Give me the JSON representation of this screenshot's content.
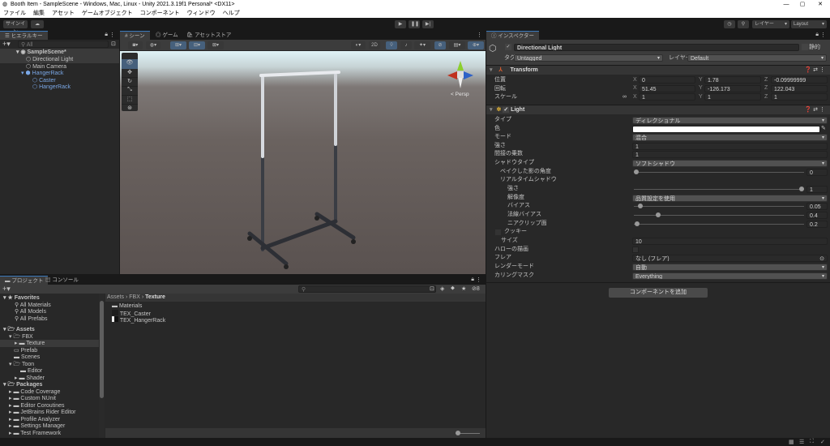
{
  "window": {
    "title": "Booth Item - SampleScene - Windows, Mac, Linux - Unity 2021.3.19f1 Personal* <DX11>"
  },
  "menu": [
    "ファイル",
    "編集",
    "アセット",
    "ゲームオブジェクト",
    "コンポーネント",
    "ウィンドウ",
    "ヘルプ"
  ],
  "toolbar": {
    "signin": "サインイン",
    "layers": "レイヤー",
    "layout": "Layout"
  },
  "hierarchy": {
    "tab": "ヒエラルキー",
    "search_placeholder": "All",
    "scene": "SampleScene*",
    "items": [
      "Directional Light",
      "Main Camera",
      "HangerRack",
      "Caster",
      "HangerRack"
    ]
  },
  "scene": {
    "tabs": [
      "シーン",
      "ゲーム",
      "アセットストア"
    ],
    "mode2d": "2D",
    "persp": "Persp"
  },
  "inspector": {
    "tab": "インスペクター",
    "object_name": "Directional Light",
    "static": "静的",
    "tag_label": "タグ",
    "tag": "Untagged",
    "layer_label": "レイヤー",
    "layer": "Default",
    "transform": {
      "title": "Transform",
      "position_label": "位置",
      "rotation_label": "回転",
      "scale_label": "スケール",
      "position": {
        "x": "0",
        "y": "1.78",
        "z": "-0.09999999"
      },
      "rotation": {
        "x": "51.45",
        "y": "-126.173",
        "z": "122.043"
      },
      "scale": {
        "x": "1",
        "y": "1",
        "z": "1"
      }
    },
    "light": {
      "title": "Light",
      "type_label": "タイプ",
      "type": "ディレクショナル",
      "color_label": "色",
      "color": "#ffffff",
      "mode_label": "モード",
      "mode": "混合",
      "intensity_label": "強さ",
      "intensity": "1",
      "indirect_label": "間接の乗数",
      "indirect": "1",
      "shadow_type_label": "シャドウタイプ",
      "shadow_type": "ソフトシャドウ",
      "baked_angle_label": "ベイクした影の角度",
      "baked_angle": "0",
      "realtime_label": "リアルタイムシャドウ",
      "strength_label": "強さ",
      "strength": "1",
      "resolution_label": "解像度",
      "resolution": "品質設定を使用",
      "bias_label": "バイアス",
      "bias": "0.05",
      "normal_bias_label": "法線バイアス",
      "normal_bias": "0.4",
      "near_plane_label": "ニアクリップ面",
      "near_plane": "0.2",
      "cookie_label": "クッキー",
      "size_label": "サイズ",
      "size": "10",
      "halo_label": "ハローの描画",
      "flare_label": "フレア",
      "flare": "なし (フレア)",
      "render_mode_label": "レンダーモード",
      "render_mode": "自動",
      "culling_label": "カリングマスク",
      "culling": "Everything"
    },
    "add_component": "コンポーネントを追加"
  },
  "project": {
    "tabs": [
      "プロジェクト",
      "コンソール"
    ],
    "favorites": {
      "title": "Favorites",
      "items": [
        "All Materials",
        "All Models",
        "All Prefabs"
      ]
    },
    "assets": {
      "title": "Assets",
      "items": [
        "FBX",
        "Texture",
        "Prefab",
        "Scenes",
        "Toon",
        "Editor",
        "Shader"
      ]
    },
    "packages": {
      "title": "Packages",
      "items": [
        "Code Coverage",
        "Custom NUnit",
        "Editor Coroutines",
        "JetBrains Rider Editor",
        "Profile Analyzer",
        "Settings Manager",
        "Test Framework"
      ]
    },
    "breadcrumb": [
      "Assets",
      "FBX",
      "Texture"
    ],
    "files": [
      "Materials",
      "TEX_Caster",
      "TEX_HangerRack"
    ],
    "hidden_count": "8"
  }
}
